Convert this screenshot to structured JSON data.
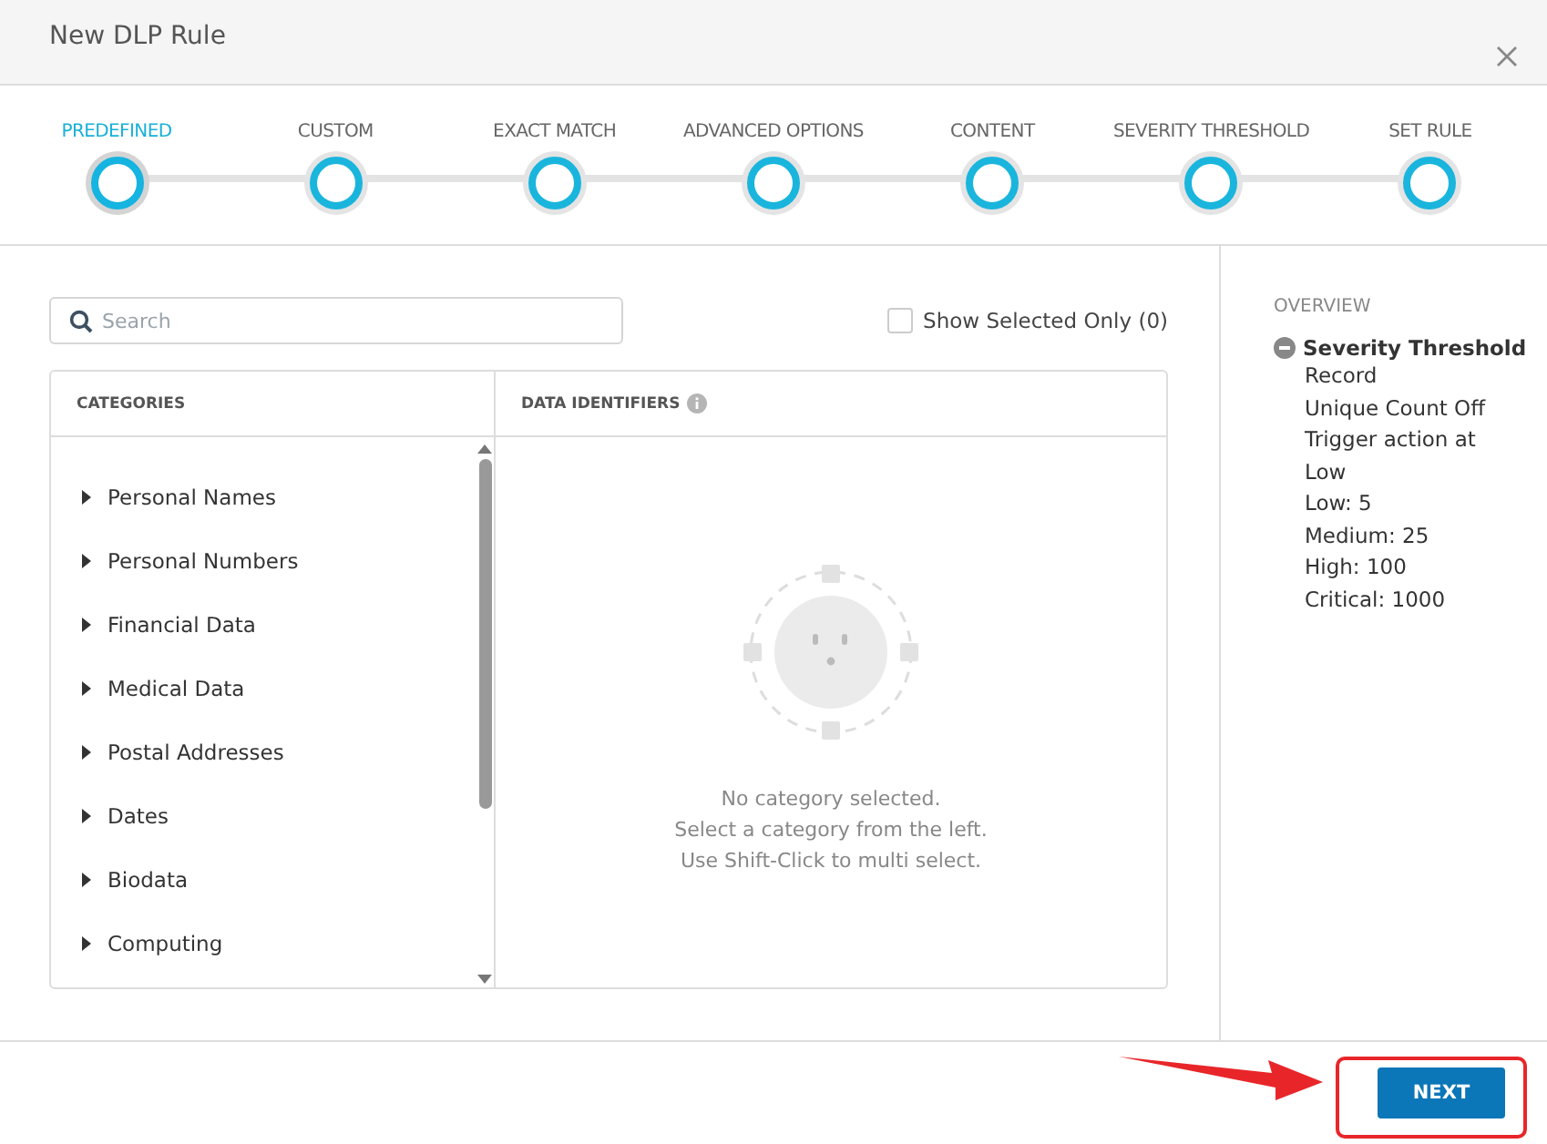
{
  "window": {
    "title": "New DLP Rule"
  },
  "steps": [
    {
      "label": "PREDEFINED",
      "selected": true
    },
    {
      "label": "CUSTOM",
      "selected": false
    },
    {
      "label": "EXACT MATCH",
      "selected": false
    },
    {
      "label": "ADVANCED OPTIONS",
      "selected": false
    },
    {
      "label": "CONTENT",
      "selected": false
    },
    {
      "label": "SEVERITY THRESHOLD",
      "selected": false
    },
    {
      "label": "SET RULE",
      "selected": false
    }
  ],
  "search": {
    "placeholder": "Search"
  },
  "show_selected": {
    "label": "Show Selected Only (0)",
    "checked": false
  },
  "table": {
    "columns": [
      "CATEGORIES",
      "DATA IDENTIFIERS"
    ],
    "categories": [
      "Personal Names",
      "Personal Numbers",
      "Financial Data",
      "Medical Data",
      "Postal Addresses",
      "Dates",
      "Biodata",
      "Computing"
    ],
    "empty_lines": [
      "No category selected.",
      "Select a category from the left.",
      "Use Shift-Click to multi select."
    ]
  },
  "overview": {
    "heading": "OVERVIEW",
    "title": "Severity Threshold",
    "lines": [
      "Record",
      "Unique Count Off",
      "Trigger action at",
      "Low",
      "Low: 5",
      "Medium: 25",
      "High: 100",
      "Critical: 1000"
    ]
  },
  "footer": {
    "button": "NEXT"
  }
}
